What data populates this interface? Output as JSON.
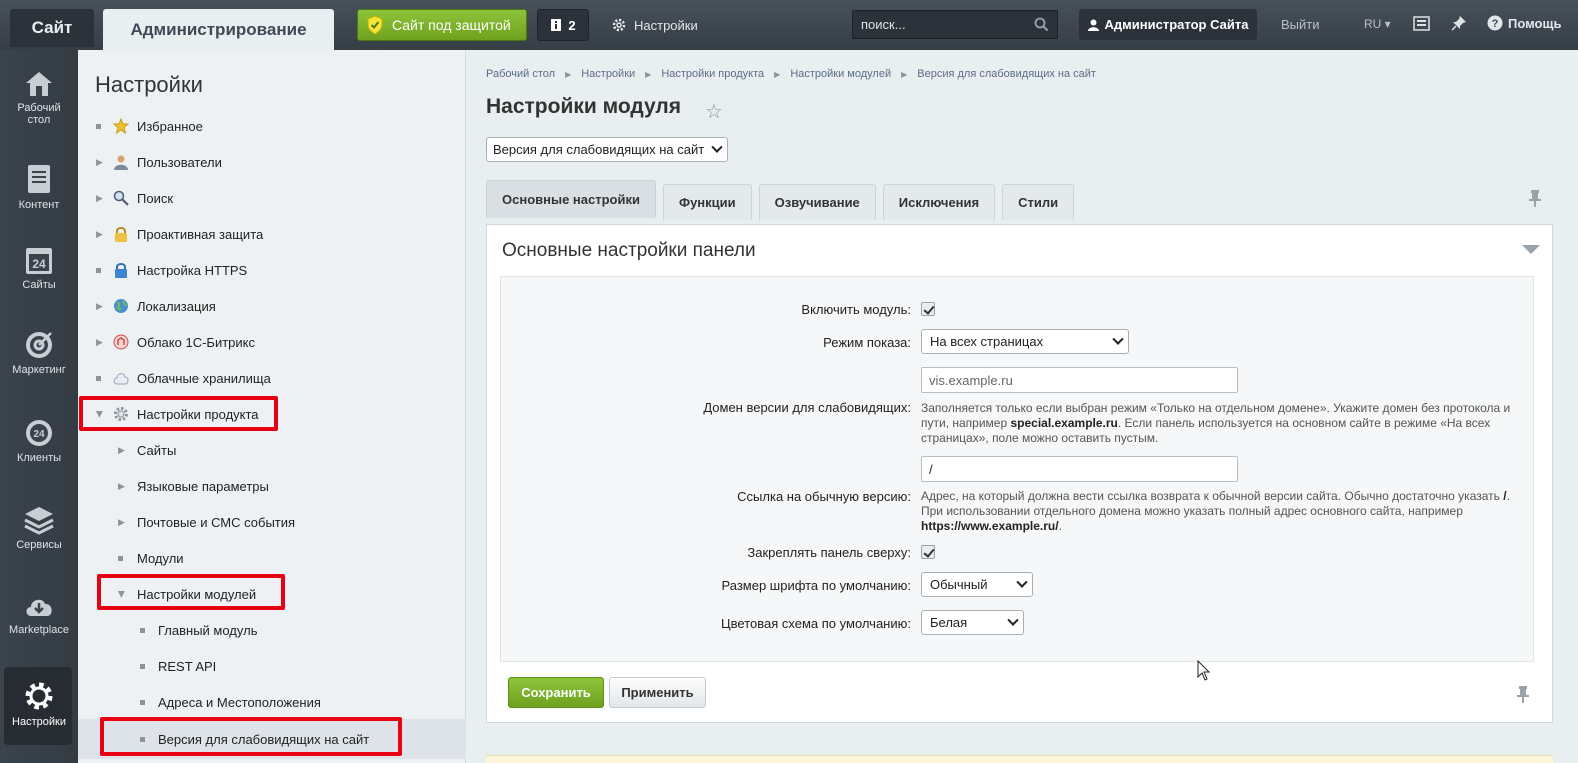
{
  "topbar": {
    "site_tab": "Сайт",
    "admin_tab": "Администрирование",
    "protected_btn": "Сайт под защитой",
    "notify_count": "2",
    "settings": "Настройки",
    "search_placeholder": "поиск...",
    "user": "Администратор Сайта",
    "logout": "Выйти",
    "lang": "RU",
    "help": "Помощь"
  },
  "leftmenu": {
    "items": [
      {
        "label1": "Рабочий",
        "label2": "стол",
        "icon": "home-icon"
      },
      {
        "label1": "Контент",
        "label2": "",
        "icon": "document-icon"
      },
      {
        "label1": "Сайты",
        "label2": "",
        "icon": "calendar-24-icon"
      },
      {
        "label1": "Маркетинг",
        "label2": "",
        "icon": "target-icon"
      },
      {
        "label1": "Клиенты",
        "label2": "",
        "icon": "clients-24-icon"
      },
      {
        "label1": "Сервисы",
        "label2": "",
        "icon": "layers-icon"
      },
      {
        "label1": "Marketplace",
        "label2": "",
        "icon": "cloud-download-icon"
      },
      {
        "label1": "Настройки",
        "label2": "",
        "icon": "gear-icon"
      }
    ]
  },
  "sidebar": {
    "title": "Настройки",
    "items": [
      {
        "label": "Избранное"
      },
      {
        "label": "Пользователи"
      },
      {
        "label": "Поиск"
      },
      {
        "label": "Проактивная защита"
      },
      {
        "label": "Настройка HTTPS"
      },
      {
        "label": "Локализация"
      },
      {
        "label": "Облако 1С-Битрикс"
      },
      {
        "label": "Облачные хранилища"
      },
      {
        "label": "Настройки продукта"
      },
      {
        "label": "Сайты"
      },
      {
        "label": "Языковые параметры"
      },
      {
        "label": "Почтовые и СМС события"
      },
      {
        "label": "Модули"
      },
      {
        "label": "Настройки модулей"
      },
      {
        "label": "Главный модуль"
      },
      {
        "label": "REST API"
      },
      {
        "label": "Адреса и Местоположения"
      },
      {
        "label": "Версия для слабовидящих на сайт"
      }
    ]
  },
  "breadcrumb": [
    "Рабочий стол",
    "Настройки",
    "Настройки продукта",
    "Настройки модулей",
    "Версия для слабовидящих на сайт"
  ],
  "page_title": "Настройки модуля",
  "module_select": "Версия для слабовидящих на сайт",
  "tabs": [
    "Основные настройки",
    "Функции",
    "Озвучивание",
    "Исключения",
    "Стили"
  ],
  "panel": {
    "title": "Основные настройки панели",
    "enable_label": "Включить модуль:",
    "mode_label": "Режим показа:",
    "mode_value": "На всех страницах",
    "domain_label": "Домен версии для слабовидящих:",
    "domain_placeholder": "vis.example.ru",
    "domain_hint_1": "Заполняется только если выбран режим «Только на отдельном домене». Укажите домен без протокола и пути, например ",
    "domain_hint_bold": "special.example.ru",
    "domain_hint_2": ". Если панель используется на основном сайте в режиме «На всех страницах», поле можно оставить пустым.",
    "link_label": "Ссылка на обычную версию:",
    "link_value": "/",
    "link_hint_1": "Адрес, на который должна вести ссылка возврата к обычной версии сайта. Обычно достаточно указать ",
    "link_hint_slash": "/",
    "link_hint_2": ". При использовании отдельного домена можно указать полный адрес основного сайта, например ",
    "link_hint_bold": "https://www.example.ru/",
    "link_hint_3": ".",
    "fix_label": "Закреплять панель сверху:",
    "font_label": "Размер шрифта по умолчанию:",
    "font_value": "Обычный",
    "scheme_label": "Цветовая схема по умолчанию:",
    "scheme_value": "Белая"
  },
  "buttons": {
    "save": "Сохранить",
    "apply": "Применить"
  },
  "colors": {
    "accent_green": "#7ab12b",
    "highlight_red": "#e60012",
    "dark": "#3a434c"
  }
}
